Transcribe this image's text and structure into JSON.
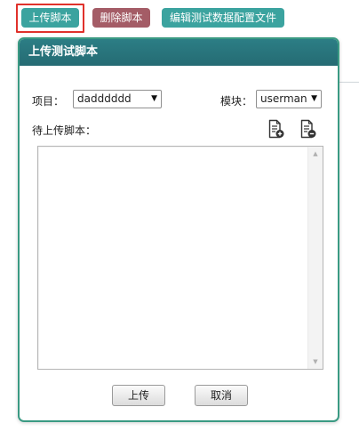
{
  "toolbar": {
    "upload_label": "上传脚本",
    "delete_label": "删除脚本",
    "edit_config_label": "编辑测试数据配置文件",
    "colors": {
      "upload": "#3ba39f",
      "delete": "#a45c66",
      "edit": "#3ba39f",
      "highlight": "#e0312b"
    }
  },
  "dialog": {
    "title": "上传测试脚本",
    "header_color": "#2a7680",
    "border_color": "#3a9a83",
    "project": {
      "label": "项目：",
      "value": "dadddddd"
    },
    "module": {
      "label": "模块：",
      "value": "userman"
    },
    "script_label": "待上传脚本：",
    "icons": {
      "add": "file-add-icon",
      "remove": "file-remove-icon"
    },
    "textarea_value": "",
    "submit_label": "上传",
    "cancel_label": "取消"
  }
}
